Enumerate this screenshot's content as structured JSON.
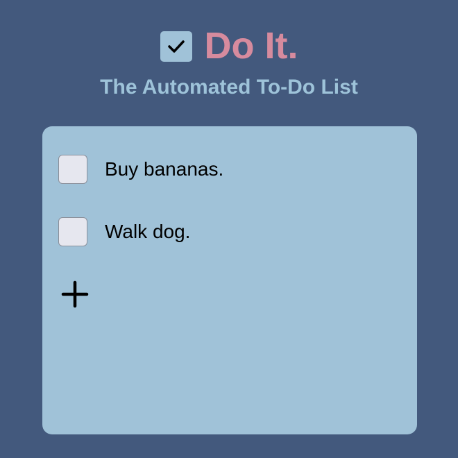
{
  "header": {
    "title": "Do It.",
    "subtitle": "The Automated To-Do List",
    "logo_icon": "checkmark-icon"
  },
  "tasks": [
    {
      "label": "Buy bananas.",
      "checked": false
    },
    {
      "label": "Walk dog.",
      "checked": false
    }
  ],
  "add_button": {
    "icon": "plus-icon"
  },
  "colors": {
    "background": "#43597d",
    "card": "#a0c2d8",
    "title": "#d68b9e",
    "subtitle": "#9ec3d9",
    "checkbox": "#e6e7ef"
  }
}
